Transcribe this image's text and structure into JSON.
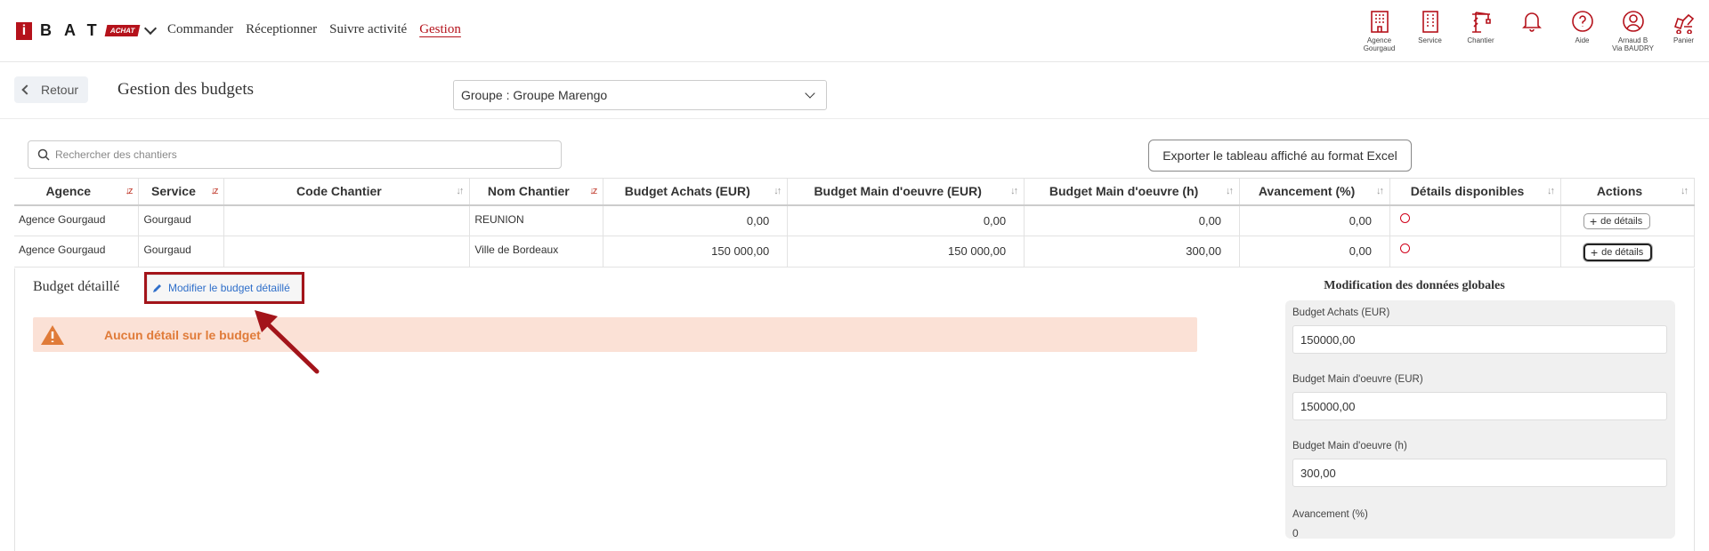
{
  "nav": {
    "logo_i": "i",
    "logo_bat": "BAT",
    "logo_badge": "ACHAT",
    "menu": [
      {
        "label": "Commander",
        "active": false
      },
      {
        "label": "Réceptionner",
        "active": false
      },
      {
        "label": "Suivre activité",
        "active": false
      },
      {
        "label": "Gestion",
        "active": true
      }
    ],
    "icons": [
      {
        "name": "building-icon",
        "label": "Agence\nGourgaud"
      },
      {
        "name": "office-icon",
        "label": "Service"
      },
      {
        "name": "crane-icon",
        "label": "Chantier"
      },
      {
        "name": "bell-icon",
        "label": ""
      },
      {
        "name": "help-icon",
        "label": "Aide"
      },
      {
        "name": "user-icon",
        "label": "Arnaud B\nVia BAUDRY"
      },
      {
        "name": "cart-icon",
        "label": "Panier"
      }
    ],
    "accent_color": "#b5121b"
  },
  "header": {
    "back_label": "Retour",
    "title": "Gestion des budgets",
    "group_select": "Groupe : Groupe Marengo"
  },
  "toolbar": {
    "search_placeholder": "Rechercher des chantiers",
    "export_label": "Exporter le tableau affiché au format Excel"
  },
  "table": {
    "columns": [
      "Agence",
      "Service",
      "Code Chantier",
      "Nom Chantier",
      "Budget Achats (EUR)",
      "Budget Main d'oeuvre (EUR)",
      "Budget Main d'oeuvre (h)",
      "Avancement (%)",
      "Détails disponibles",
      "Actions"
    ],
    "rows": [
      {
        "agence": "Agence Gourgaud",
        "service": "Gourgaud",
        "code": "",
        "nom": "REUNION",
        "achats": "0,00",
        "mo_eur": "0,00",
        "mo_h": "0,00",
        "avancement": "0,00",
        "action": "de détails"
      },
      {
        "agence": "Agence Gourgaud",
        "service": "Gourgaud",
        "code": "",
        "nom": "Ville de Bordeaux",
        "achats": "150 000,00",
        "mo_eur": "150 000,00",
        "mo_h": "300,00",
        "avancement": "0,00",
        "action": "de détails"
      }
    ]
  },
  "detail": {
    "title": "Budget détaillé",
    "modify_label": "Modifier le budget détaillé",
    "alert_text": "Aucun détail sur le budget",
    "alert_color": "#fbe1d6"
  },
  "global": {
    "title": "Modification des données globales",
    "fields": [
      {
        "label": "Budget Achats (EUR)",
        "value": "150000,00"
      },
      {
        "label": "Budget Main d'oeuvre (EUR)",
        "value": "150000,00"
      },
      {
        "label": "Budget Main d'oeuvre (h)",
        "value": "300,00"
      }
    ],
    "avancement_label": "Avancement (%)",
    "avancement_value": "0"
  }
}
